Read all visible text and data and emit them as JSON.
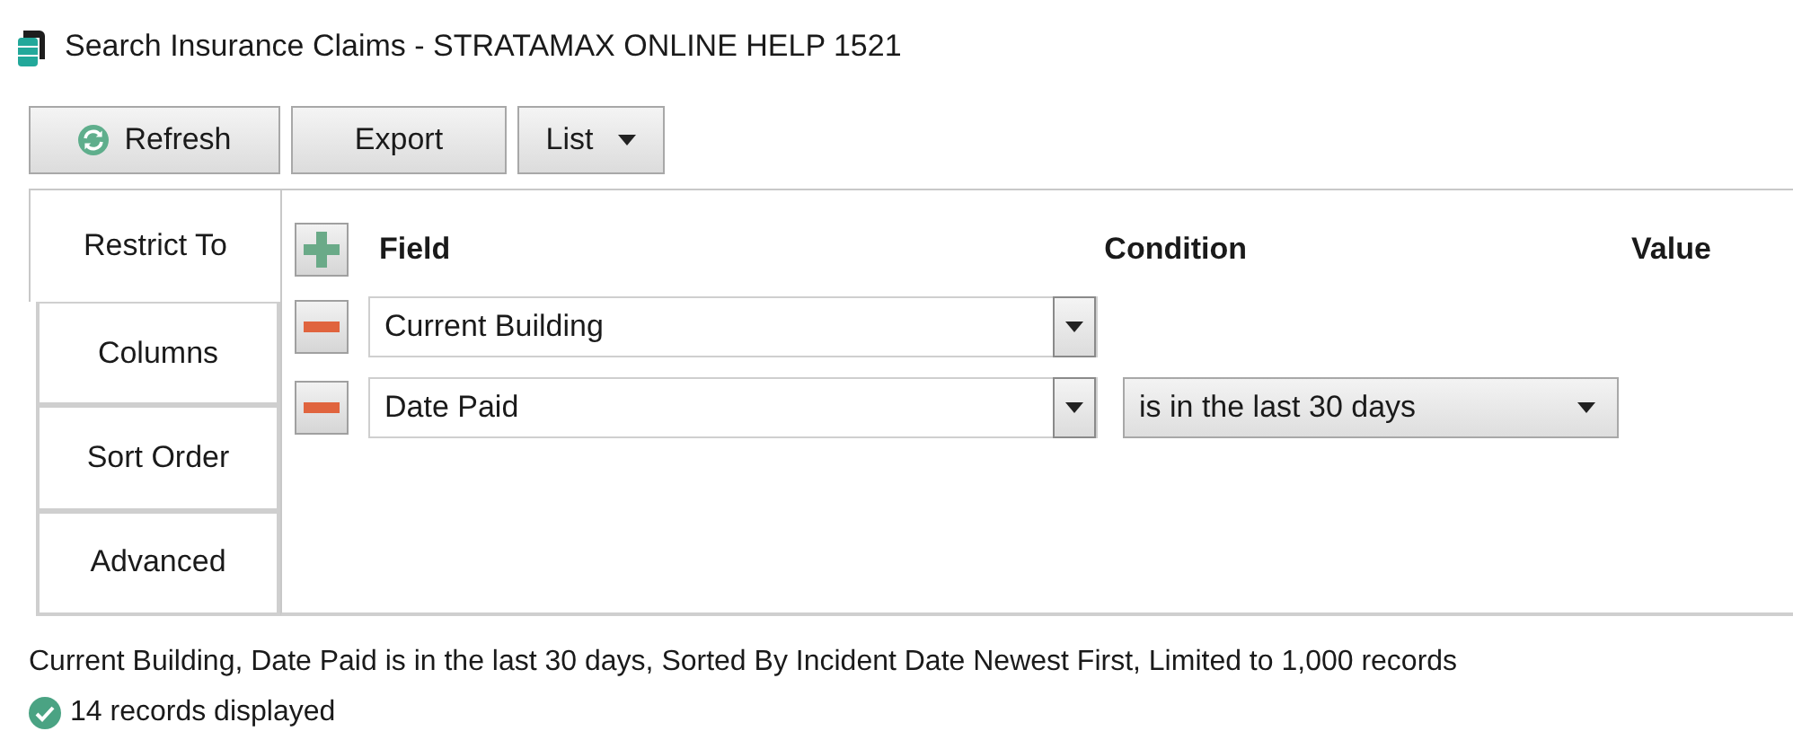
{
  "window": {
    "title": "Search Insurance Claims - STRATAMAX ONLINE HELP 1521"
  },
  "toolbar": {
    "buttons": [
      {
        "kind": "refresh",
        "label": "Refresh"
      },
      {
        "kind": "plain",
        "label": "Export"
      },
      {
        "kind": "dropdown",
        "label": "List"
      }
    ]
  },
  "tabs": [
    {
      "label": "Restrict To",
      "selected": true
    },
    {
      "label": "Columns",
      "selected": false
    },
    {
      "label": "Sort Order",
      "selected": false
    },
    {
      "label": "Advanced",
      "selected": false
    }
  ],
  "criteria": {
    "columns": [
      "Field",
      "Condition",
      "Value"
    ],
    "rows": [
      {
        "field": "Current Building"
      },
      {
        "field": "Date Paid",
        "condition": "is in the last 30 days"
      }
    ]
  },
  "summary": "Current Building, Date Paid is in the last 30 days, Sorted By Incident Date Newest First, Limited to 1,000 records",
  "status": {
    "kind": "ok",
    "text": "14 records displayed"
  }
}
